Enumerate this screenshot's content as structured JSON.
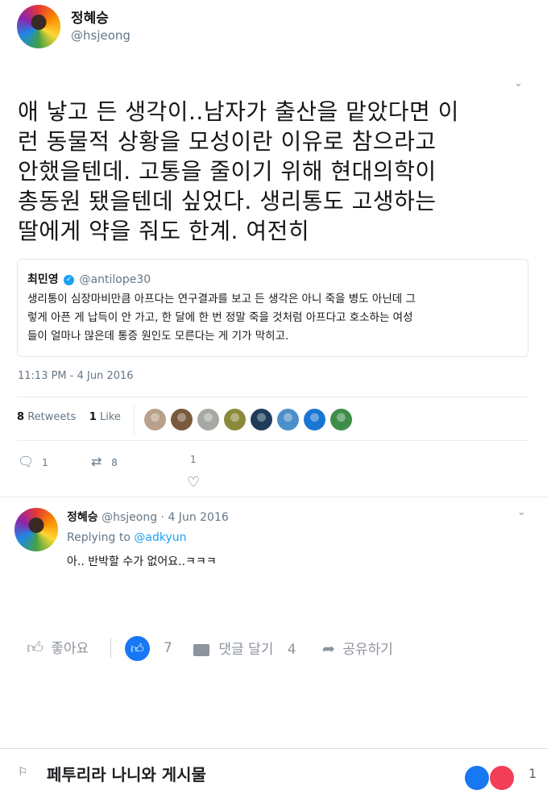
{
  "tweet": {
    "display_name": "정혜승",
    "handle": "@hsjeong",
    "text_lines": [
      "애 낳고 든 생각이..남자가 출산을 맡았다면 이",
      "런 동물적 상황을 모성이란 이유로 참으라고",
      "안했을텐데. 고통을 줄이기 위해 현대의학이",
      "총동원 됐을텐데 싶었다. 생리통도 고생하는",
      "딸에게 약을 줘도 한계. 여전히"
    ],
    "quote": {
      "name": "최민영",
      "handle": "@antilope30",
      "lines": [
        "생리통이 심장마비만큼 아프다는 연구결과를 보고 든 생각은 아니 죽을 병도 아닌데 그",
        "렇게 아픈 게 납득이 안 가고, 한 달에 한 번 정말 죽을 것처럼 아프다고 호소하는 여성",
        "들이 얼마나 많은데 통증 원인도 모른다는 게 기가 막히고."
      ]
    },
    "timestamp": "11:13 PM - 4 Jun 2016",
    "retweets_count": "8",
    "retweets_label": "Retweets",
    "likes_count": "1",
    "likes_label": "Like",
    "likers": [
      {
        "color": "#b9a08a"
      },
      {
        "color": "#7a5a3c"
      },
      {
        "color": "#a7a8a2"
      },
      {
        "color": "#8c8a3a"
      },
      {
        "color": "#1f3d5a"
      },
      {
        "color": "#4a8fc9"
      },
      {
        "color": "#1976d2"
      },
      {
        "color": "#3e8e4a"
      }
    ],
    "reply_count": "1",
    "retweet_action_count": "8",
    "like_action_count": "1"
  },
  "reply": {
    "display_name": "정혜승",
    "handle": "@hsjeong",
    "date": "4 Jun 2016",
    "replying_prefix": "Replying to",
    "replying_handle": "@adkyun",
    "text": "아.. 반박할 수가 없어요..ㅋㅋㅋ"
  },
  "facebook_bar": {
    "like_label": "좋아요",
    "like_count": "7",
    "comment_label": "댓글 달기",
    "comment_count": "4",
    "share_label": "공유하기"
  },
  "next_post": {
    "title": "페투리라 나니와 게시물",
    "reaction_count": "1"
  },
  "colors": {
    "twitter_blue": "#1da1f2",
    "fb_blue": "#1877f2",
    "muted": "#657786"
  }
}
